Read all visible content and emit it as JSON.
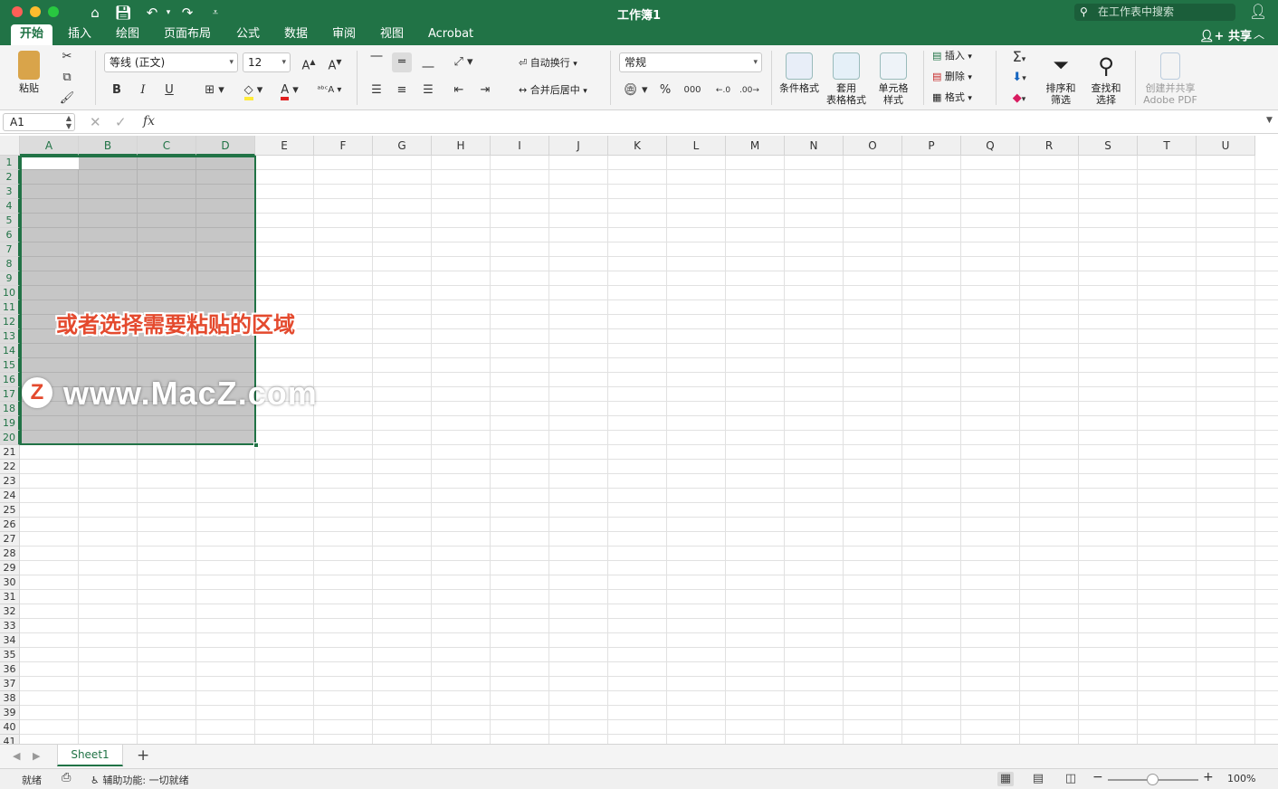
{
  "window": {
    "title": "工作簿1",
    "search_placeholder": "在工作表中搜索",
    "share_label": "共享"
  },
  "tabs": [
    {
      "label": "开始",
      "active": true
    },
    {
      "label": "插入"
    },
    {
      "label": "绘图"
    },
    {
      "label": "页面布局"
    },
    {
      "label": "公式"
    },
    {
      "label": "数据"
    },
    {
      "label": "审阅"
    },
    {
      "label": "视图"
    },
    {
      "label": "Acrobat"
    }
  ],
  "ribbon": {
    "paste_label": "粘贴",
    "font_name": "等线 (正文)",
    "font_size": "12",
    "bold": "B",
    "italic": "I",
    "underline": "U",
    "wrap_text": "自动换行",
    "merge_center": "合并后居中",
    "number_format": "常规",
    "percent": "%",
    "thousands": "000",
    "conditional_format": "条件格式",
    "table_format_1": "套用",
    "table_format_2": "表格格式",
    "cell_style_1": "单元格",
    "cell_style_2": "样式",
    "insert": "插入",
    "delete": "删除",
    "format": "格式",
    "sort_filter_1": "排序和",
    "sort_filter_2": "筛选",
    "find_select_1": "查找和",
    "find_select_2": "选择",
    "create_share_1": "创建并共享",
    "create_share_2": "Adobe PDF"
  },
  "formula_bar": {
    "name_box": "A1",
    "fx": "fx",
    "content": ""
  },
  "grid": {
    "columns": [
      "A",
      "B",
      "C",
      "D",
      "E",
      "F",
      "G",
      "H",
      "I",
      "J",
      "K",
      "L",
      "M",
      "N",
      "O",
      "P",
      "Q",
      "R",
      "S",
      "T",
      "U"
    ],
    "rows": [
      "1",
      "2",
      "3",
      "4",
      "5",
      "6",
      "7",
      "8",
      "9",
      "10",
      "11",
      "12",
      "13",
      "14",
      "15",
      "16",
      "17",
      "18",
      "19",
      "20",
      "21",
      "22",
      "23",
      "24",
      "25",
      "26",
      "27",
      "28",
      "29",
      "30",
      "31",
      "32",
      "33",
      "34",
      "35",
      "36",
      "37",
      "38",
      "39",
      "40",
      "41"
    ],
    "selected_range": "A1:D20",
    "selected_columns": [
      "A",
      "B",
      "C",
      "D"
    ],
    "selected_rows_count": 20
  },
  "overlay": {
    "caption": "或者选择需要粘贴的区域",
    "watermark_logo": "Z",
    "watermark_text": "www.MacZ.com"
  },
  "sheets": {
    "tabs": [
      "Sheet1"
    ],
    "add": "+"
  },
  "status": {
    "ready": "就绪",
    "accessibility": "辅助功能: 一切就绪",
    "zoom": "100%",
    "zoom_minus": "−",
    "zoom_plus": "+"
  },
  "colors": {
    "brand": "#217346",
    "caption": "#e44a2e",
    "selection": "#c6c6c6"
  }
}
